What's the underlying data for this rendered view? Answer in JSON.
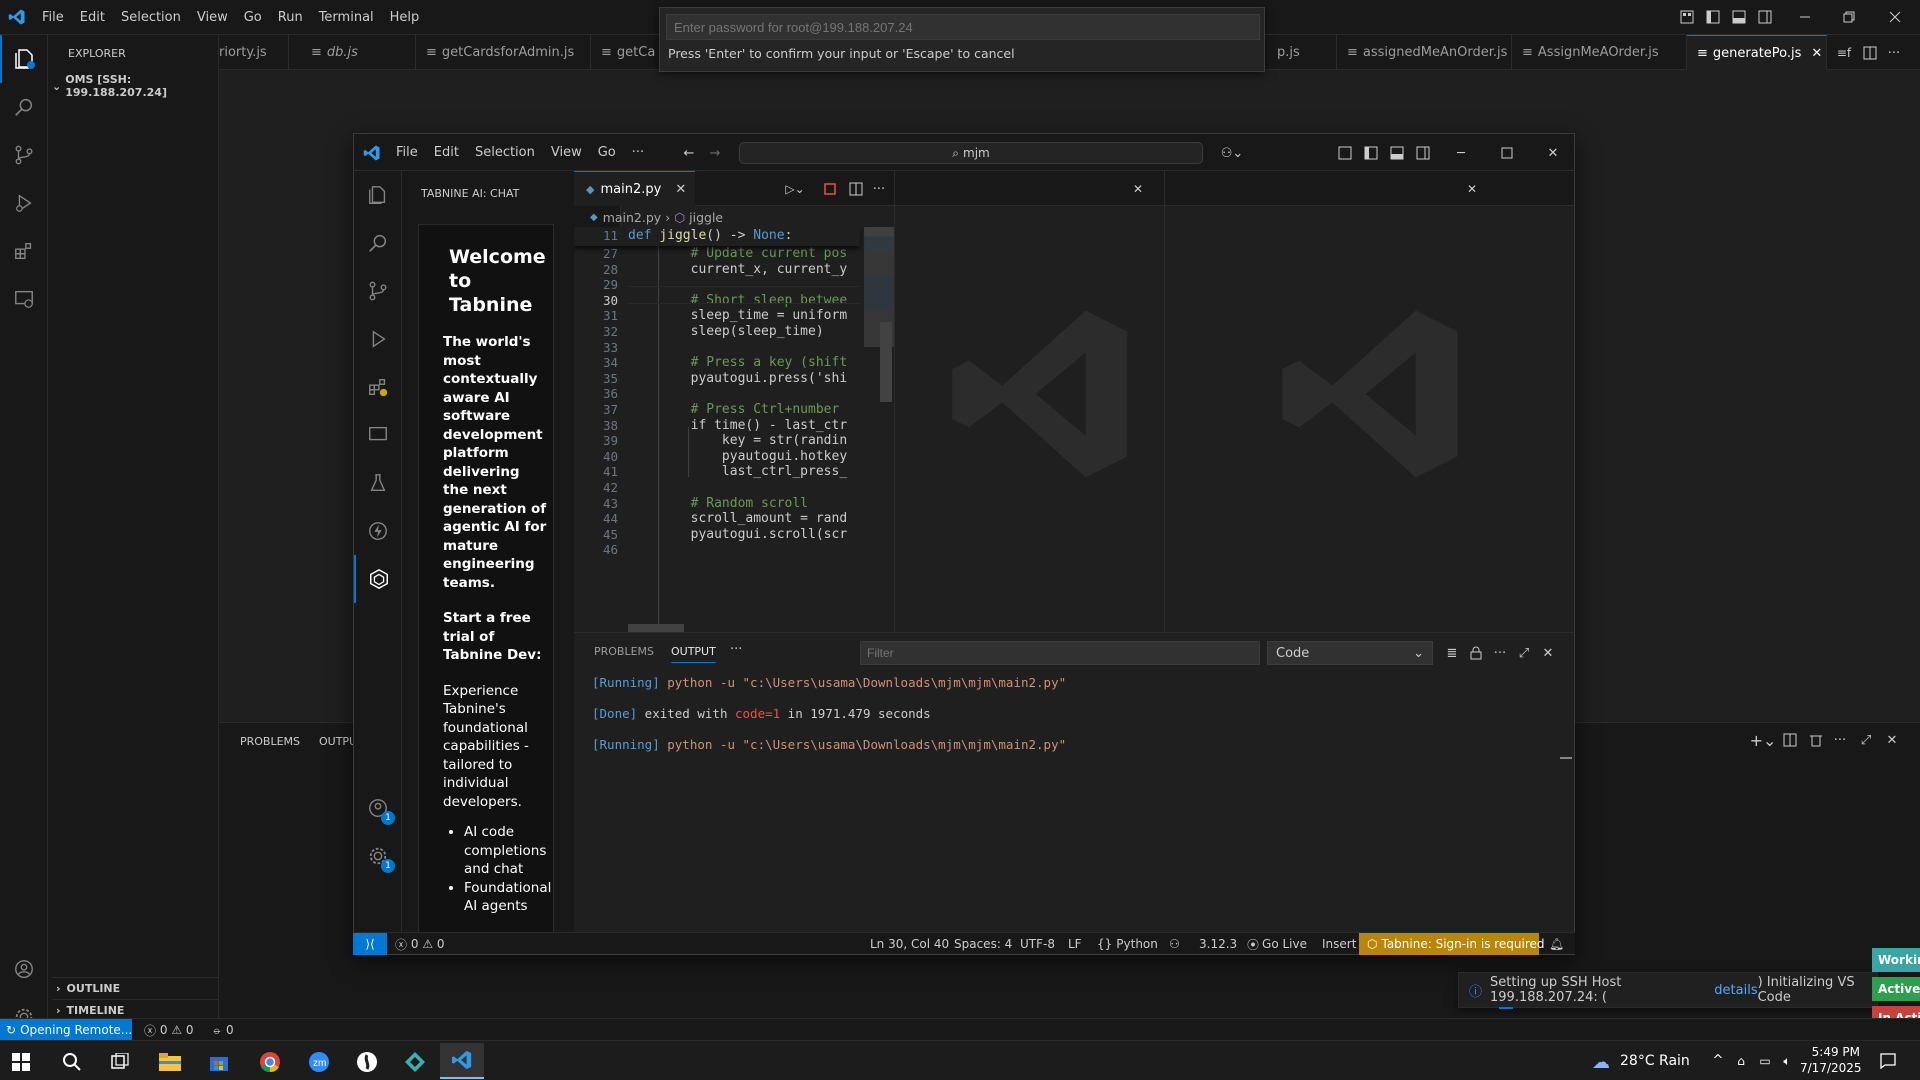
{
  "outer": {
    "menu": [
      "File",
      "Edit",
      "Selection",
      "View",
      "Go",
      "Run",
      "Terminal",
      "Help"
    ],
    "explorer_title": "EXPLORER",
    "root_folder": "OMS [SSH: 199.188.207.24]",
    "tabs": [
      "riorty.js",
      "db.js",
      "getCardsforAdmin.js",
      "getCa",
      "p.js",
      "assignedMeAnOrder.js",
      "AssignMeAOrder.js",
      "generatePo.js"
    ],
    "quick_input": {
      "placeholder": "Enter password for root@199.188.207.24",
      "hint": "Press 'Enter' to confirm your input or 'Escape' to cancel"
    },
    "panel_tabs": [
      "PROBLEMS",
      "OUTPU"
    ],
    "outline": "OUTLINE",
    "timeline": "TIMELINE",
    "status": {
      "remote": "Opening Remote...",
      "errors": "0",
      "warnings": "0",
      "ports": "0"
    },
    "notification": {
      "prefix": "Setting up SSH Host 199.188.207.24: (",
      "link": "details",
      "suffix": ") Initializing VS Code"
    },
    "side_pills": [
      {
        "label": "Workin",
        "color": "#3aa5a5"
      },
      {
        "label": "Active",
        "color": "#2e9f4d"
      },
      {
        "label": "In Acti",
        "color": "#c8413a"
      }
    ],
    "badge_count": "1"
  },
  "inner": {
    "menu": [
      "File",
      "Edit",
      "Selection",
      "View",
      "Go",
      "···"
    ],
    "search": "mjm",
    "sidebar_title": "TABNINE AI: CHAT",
    "tab": "main2.py",
    "breadcrumb": [
      "main2.py",
      "jiggle"
    ],
    "sticky_line": {
      "num": "11",
      "text": "def jiggle() -> None:"
    },
    "code_lines": [
      {
        "num": "27",
        "text": "        # Update current pos",
        "kind": "comment"
      },
      {
        "num": "28",
        "text": "        current_x, current_y",
        "kind": "code"
      },
      {
        "num": "29",
        "text": "",
        "kind": "code"
      },
      {
        "num": "30",
        "text": "        # Short sleep betwee",
        "kind": "comment"
      },
      {
        "num": "31",
        "text": "        sleep_time = uniform",
        "kind": "code"
      },
      {
        "num": "32",
        "text": "        sleep(sleep_time)",
        "kind": "code"
      },
      {
        "num": "33",
        "text": "",
        "kind": "code"
      },
      {
        "num": "34",
        "text": "        # Press a key (shift",
        "kind": "comment"
      },
      {
        "num": "35",
        "text": "        pyautogui.press('shi",
        "kind": "code"
      },
      {
        "num": "36",
        "text": "",
        "kind": "code"
      },
      {
        "num": "37",
        "text": "        # Press Ctrl+number",
        "kind": "comment"
      },
      {
        "num": "38",
        "text": "        if time() - last_ctr",
        "kind": "code"
      },
      {
        "num": "39",
        "text": "            key = str(randin",
        "kind": "code"
      },
      {
        "num": "40",
        "text": "            pyautogui.hotkey",
        "kind": "code"
      },
      {
        "num": "41",
        "text": "            last_ctrl_press_",
        "kind": "code"
      },
      {
        "num": "42",
        "text": "",
        "kind": "code"
      },
      {
        "num": "43",
        "text": "        # Random scroll",
        "kind": "comment"
      },
      {
        "num": "44",
        "text": "        scroll_amount = rand",
        "kind": "code"
      },
      {
        "num": "45",
        "text": "        pyautogui.scroll(scr",
        "kind": "code"
      },
      {
        "num": "46",
        "text": "",
        "kind": "code"
      }
    ],
    "tabnine": {
      "heading": "Welcome to Tabnine",
      "subheading": "The world's most contextually aware AI software development platform delivering the next generation of agentic AI for mature engineering teams.",
      "trial_heading": "Start a free trial of Tabnine Dev:",
      "body": "Experience Tabnine's foundational capabilities - tailored to individual developers.",
      "bullets": [
        "AI code completions and chat",
        "Foundational AI agents"
      ]
    },
    "panel_tabs": [
      "PROBLEMS",
      "OUTPUT",
      "···"
    ],
    "filter_placeholder": "Filter",
    "output_channel": "Code",
    "output_lines": [
      {
        "tag": "[Running]",
        "text": " python -u \"c:\\Users\\usama\\Downloads\\mjm\\mjm\\main2.py\""
      },
      {
        "tag": "",
        "text": ""
      },
      {
        "tag": "[Done]",
        "text": " exited with ",
        "code": "code=1",
        "rest": " in 1971.479 seconds"
      },
      {
        "tag": "",
        "text": ""
      },
      {
        "tag": "[Running]",
        "text": " python -u \"c:\\Users\\usama\\Downloads\\mjm\\mjm\\main2.py\""
      }
    ],
    "status": {
      "errors": "0",
      "warnings": "0",
      "position": "Ln 30, Col 40",
      "spaces": "Spaces: 4",
      "encoding": "UTF-8",
      "eol": "LF",
      "language": "Python",
      "version": "3.12.3",
      "golive": "Go Live",
      "mode": "Insert",
      "tabnine": "Tabnine: Sign-in is required"
    },
    "badge_count": "1"
  },
  "taskbar": {
    "weather": "28°C  Rain",
    "time": "5:49 PM",
    "date": "7/17/2025"
  },
  "colors": {
    "accent": "#0078d4",
    "tabnine_status": "#b8860b",
    "remote": "#0078d4"
  }
}
